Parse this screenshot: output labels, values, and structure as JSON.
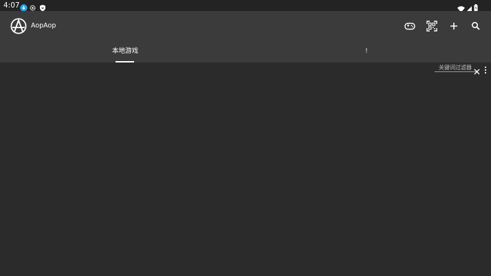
{
  "status_bar": {
    "time": "4:07",
    "left_icons": [
      "download-notification-icon",
      "settings-gear-icon",
      "shield-icon"
    ],
    "right_icons": [
      "wifi-icon",
      "cellular-signal-icon",
      "battery-icon"
    ]
  },
  "app_bar": {
    "logo_icon": "anarchy-a-logo-icon",
    "title": "AopAop",
    "actions": [
      "gamepad-icon",
      "qr-scan-icon",
      "add-icon",
      "search-icon"
    ]
  },
  "tabs": [
    {
      "label": "本地游戏",
      "selected": true
    },
    {
      "label": "!",
      "selected": false
    }
  ],
  "filter": {
    "placeholder": "关键词过滤器",
    "value": ""
  },
  "colors": {
    "status_bar_bg": "#232323",
    "app_bar_bg": "#3b3b3b",
    "content_bg": "#2b2b2b",
    "text": "#ffffff"
  }
}
